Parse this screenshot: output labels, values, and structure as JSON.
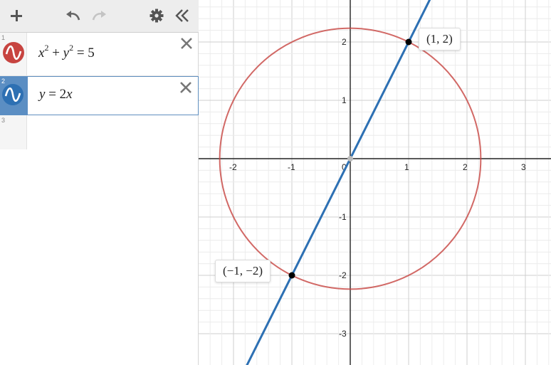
{
  "toolbar": {
    "add_icon": "plus-icon",
    "undo_icon": "undo-icon",
    "redo_icon": "redo-icon",
    "settings_icon": "gear-icon",
    "collapse_icon": "double-chevron-left-icon"
  },
  "expressions": [
    {
      "index": "1",
      "color": "#c74440",
      "selected": false
    },
    {
      "index": "2",
      "color": "#2d70b3",
      "selected": true
    },
    {
      "index": "3",
      "color": "",
      "selected": false
    }
  ],
  "graph": {
    "x_ticks": [
      "-2",
      "-1",
      "0",
      "1",
      "2",
      "3"
    ],
    "y_ticks": [
      "2",
      "1",
      "-1",
      "-2",
      "-3"
    ],
    "point_labels": [
      "(1, 2)",
      "(−1, −2)"
    ],
    "circle_color": "#c74440",
    "line_color": "#2d70b3"
  },
  "chart_data": {
    "type": "line",
    "series": [
      {
        "equation": "x^2 + y^2 = 5",
        "color": "#c74440"
      },
      {
        "equation": "y = 2x",
        "color": "#2d70b3"
      }
    ],
    "points": [
      {
        "x": 1,
        "y": 2,
        "label": "(1, 2)"
      },
      {
        "x": -1,
        "y": -2,
        "label": "(−1, −2)"
      }
    ],
    "xlim": [
      -2.6,
      3.4
    ],
    "ylim": [
      -3.5,
      2.7
    ],
    "grid": true
  }
}
